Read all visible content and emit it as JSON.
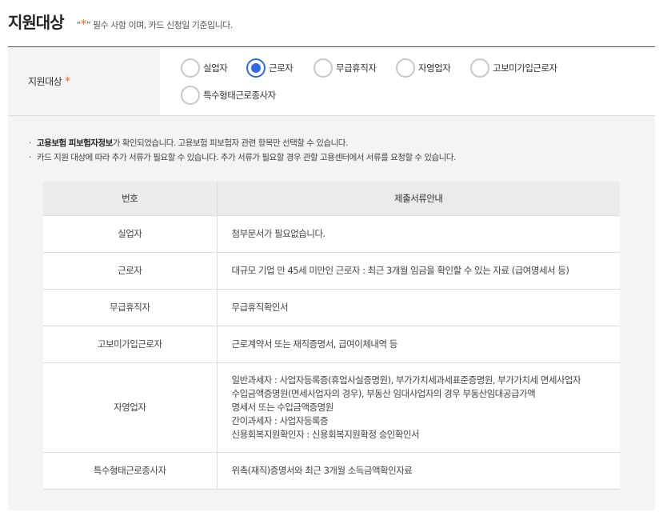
{
  "header": {
    "title": "지원대상",
    "note_open": "“",
    "note_star": "*",
    "note_text": "” 필수 사항 이며, 카드 신청일 기준입니다."
  },
  "form": {
    "label": "지원대상",
    "required_mark": "*",
    "options": [
      {
        "label": "실업자",
        "checked": false
      },
      {
        "label": "근로자",
        "checked": true
      },
      {
        "label": "무급휴직자",
        "checked": false
      },
      {
        "label": "자영업자",
        "checked": false
      },
      {
        "label": "고보미가입근로자",
        "checked": false
      },
      {
        "label": "특수형태근로종사자",
        "checked": false
      }
    ]
  },
  "info": {
    "bullet1_bold": "고용보험 피보험자정보",
    "bullet1_rest": "가 확인되었습니다. 고용보험 피보험자 관련 항목만 선택할 수 있습니다.",
    "bullet2": "카드 지원 대상에 따라 추가 서류가 필요할 수 있습니다. 추가 서류가 필요할 경우 관할 고용센터에서 서류를 요청할 수 있습니다."
  },
  "table": {
    "headers": [
      "번호",
      "제출서류안내"
    ],
    "rows": [
      {
        "category": "실업자",
        "lines": [
          "첨부문서가 필요없습니다."
        ]
      },
      {
        "category": "근로자",
        "lines": [
          "대규모 기업 만 45세 미만인 근로자 : 최근 3개월 임금을 확인할 수 있는 자료 (급여명세서 등)"
        ]
      },
      {
        "category": "무급휴직자",
        "lines": [
          "무급휴직확인서"
        ]
      },
      {
        "category": "고보미가입근로자",
        "lines": [
          "근로계약서 또는 재직증명서, 급여이체내역 등"
        ]
      },
      {
        "category": "자영업자",
        "lines": [
          "일반과세자 : 사업자등록증(휴업사실증명원), 부가가치세과세표준증명원, 부가가치세 면세사업자",
          "수입금액증명원(면세사업자의 경우), 부동산 임대사업자의 경우 부동산임대공급가액",
          "명세서 또는 수입금액증명원",
          "간이과세자 : 사업자등록증",
          "신용회복지원확인자 : 신용회복지원확정 승인확인서"
        ]
      },
      {
        "category": "특수형태근로종사자",
        "lines": [
          "위촉(재직)증명서와 최근 3개월 소득금액확인자료"
        ]
      }
    ]
  }
}
